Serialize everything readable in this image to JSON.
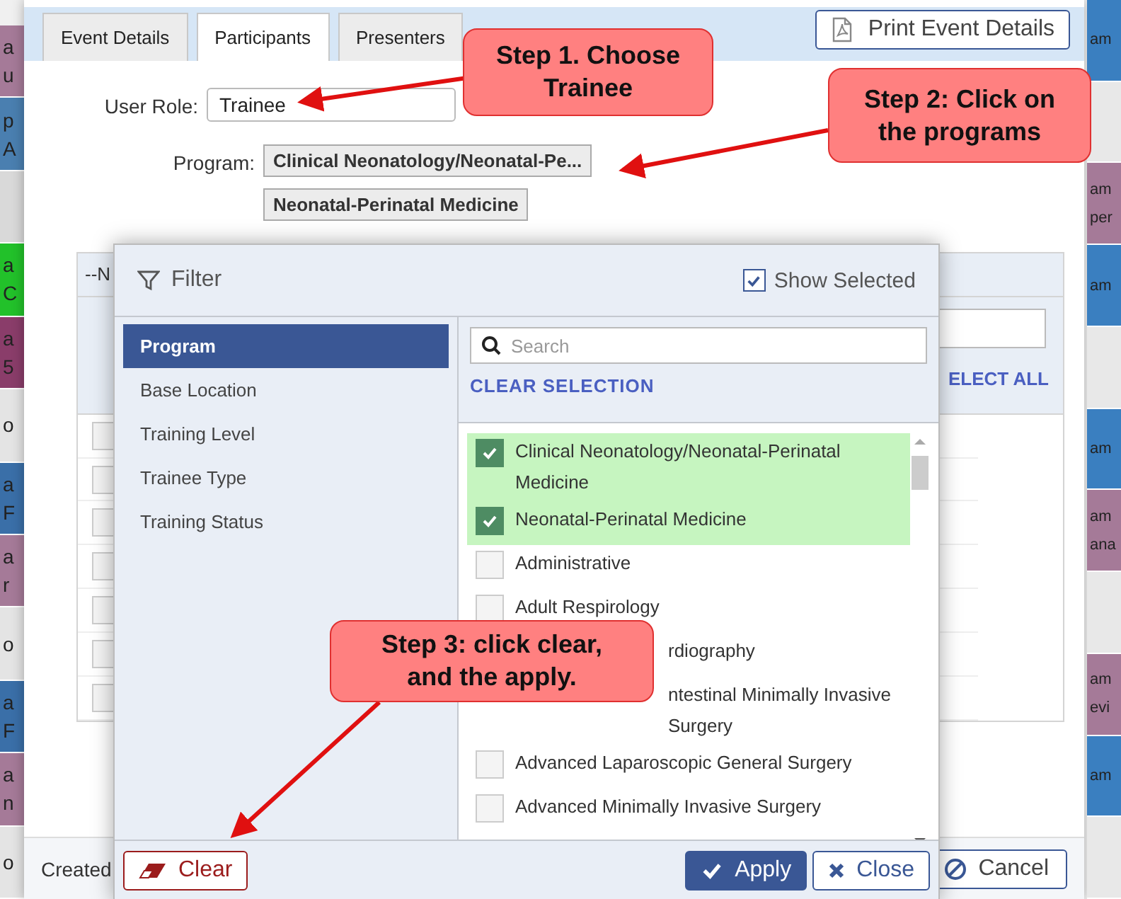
{
  "left_strip": [
    {
      "color": "#a57a98",
      "lines": [
        "a",
        "u"
      ]
    },
    {
      "color": "#4a7fb0",
      "lines": [
        "p",
        "A"
      ]
    },
    {
      "color": "#d9d9d9"
    },
    {
      "color": "#22c12a",
      "lines": [
        "a",
        "C"
      ]
    },
    {
      "color": "#8a3d6a",
      "lines": [
        "a",
        "5"
      ]
    },
    {
      "color": "#e4e4e4",
      "lines": [
        "o"
      ]
    },
    {
      "color": "#3a6fa8",
      "lines": [
        "a",
        "F"
      ]
    },
    {
      "color": "#a57a98",
      "lines": [
        "a",
        "r"
      ]
    },
    {
      "color": "#e4e4e4",
      "lines": [
        "o"
      ]
    },
    {
      "color": "#3a6fa8",
      "lines": [
        "a",
        "F"
      ]
    },
    {
      "color": "#a57a98",
      "lines": [
        "a",
        "n"
      ]
    },
    {
      "color": "#e4e4e4",
      "lines": [
        "o"
      ]
    }
  ],
  "right_strip": [
    {
      "color": "#3a7fc0",
      "lines": [
        "am"
      ]
    },
    {
      "color": "#e8e8e8"
    },
    {
      "color": "#a57a98",
      "lines": [
        "am",
        "per"
      ]
    },
    {
      "color": "#3a7fc0",
      "lines": [
        "am"
      ]
    },
    {
      "color": "#e8e8e8"
    },
    {
      "color": "#3a7fc0",
      "lines": [
        "am"
      ]
    },
    {
      "color": "#a57a98",
      "lines": [
        "am",
        "ana"
      ]
    },
    {
      "color": "#e8e8e8"
    },
    {
      "color": "#a57a98",
      "lines": [
        "am",
        "evi"
      ]
    },
    {
      "color": "#3a7fc0",
      "lines": [
        "am"
      ]
    },
    {
      "color": "#e8e8e8"
    }
  ],
  "dialog": {
    "tabs": [
      {
        "label": "Event Details",
        "selected": false
      },
      {
        "label": "Participants",
        "selected": true
      },
      {
        "label": "Presenters",
        "selected": false
      }
    ],
    "print_button": "Print Event Details",
    "user_role": {
      "label": "User Role:",
      "value": "Trainee"
    },
    "program": {
      "label": "Program:",
      "chips": [
        "Clinical Neonatology/Neonatal-Pe...",
        "Neonatal-Perinatal Medicine"
      ]
    },
    "participants_panel": {
      "header": "--N",
      "select_all": "ELECT ALL",
      "rows": [
        {
          "checked": false
        },
        {
          "checked": false
        },
        {
          "checked": false
        },
        {
          "checked": false
        },
        {
          "checked": false
        },
        {
          "checked": false
        },
        {
          "checked": false
        }
      ]
    },
    "footer": {
      "created": "Created",
      "cancel": "Cancel"
    }
  },
  "filter_modal": {
    "title": "Filter",
    "show_selected": {
      "label": "Show Selected",
      "checked": true
    },
    "categories": [
      {
        "label": "Program",
        "selected": true
      },
      {
        "label": "Base Location",
        "selected": false
      },
      {
        "label": "Training Level",
        "selected": false
      },
      {
        "label": "Trainee Type",
        "selected": false
      },
      {
        "label": "Training Status",
        "selected": false
      }
    ],
    "search": {
      "placeholder": "Search"
    },
    "clear_selection": "CLEAR SELECTION",
    "options": [
      {
        "kind": "full",
        "label": "Clinical Neonatology/Neonatal-Perinatal Medicine",
        "checked": true
      },
      {
        "kind": "full",
        "label": "Neonatal-Perinatal Medicine",
        "checked": true
      },
      {
        "kind": "full",
        "label": "Administrative",
        "checked": false
      },
      {
        "kind": "full",
        "label": "Adult Respirology",
        "checked": false
      },
      {
        "kind": "partial",
        "label": "rdiography"
      },
      {
        "kind": "partial",
        "label": "ntestinal Minimally Invasive Surgery"
      },
      {
        "kind": "full",
        "label": "Advanced Laparoscopic General Surgery",
        "checked": false
      },
      {
        "kind": "full",
        "label": "Advanced Minimally Invasive Surgery",
        "checked": false
      }
    ],
    "buttons": {
      "clear": "Clear",
      "apply": "Apply",
      "close": "Close"
    }
  },
  "callouts": [
    {
      "text": "Step 1. Choose Trainee"
    },
    {
      "text": "Step 2: Click on the programs"
    },
    {
      "text": "Step 3: click clear, and the apply."
    }
  ]
}
